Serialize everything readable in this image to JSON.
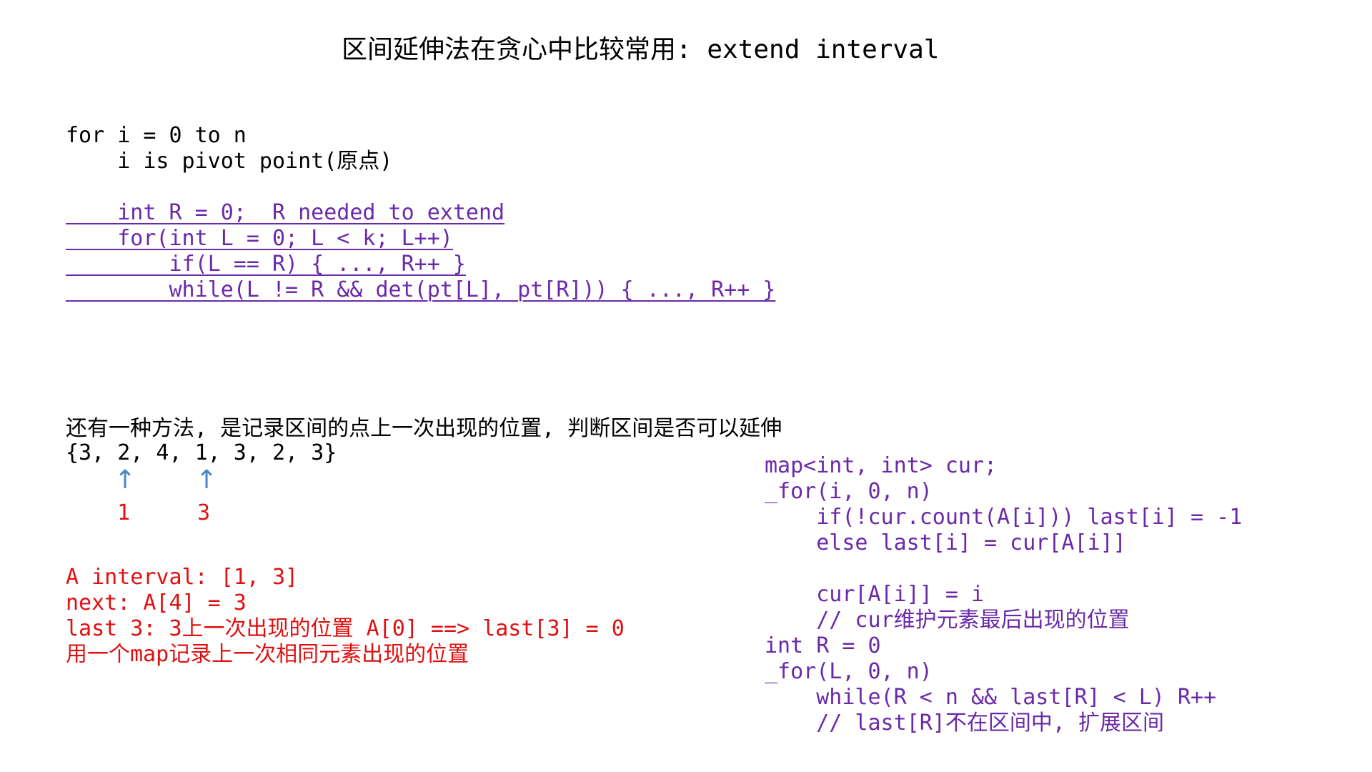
{
  "title": "区间延伸法在贪心中比较常用: extend interval",
  "top_code": {
    "line1": "for i = 0 to n",
    "line2": "    i is pivot point(原点)",
    "line3": "    int R = 0;  R needed to extend",
    "line4": "    for(int L = 0; L < k; L++)",
    "line5": "        if(L == R) { ..., R++ }",
    "line6": "        while(L != R && det(pt[L], pt[R])) { ..., R++ }"
  },
  "desc": {
    "line1": "还有一种方法, 是记录区间的点上一次出现的位置, 判断区间是否可以延伸",
    "array": "{3, 2, 4, 1, 3, 2, 3}",
    "arrow1": "↑",
    "arrow2": "↑",
    "label1": "1",
    "label2": "3"
  },
  "red_notes": {
    "line1": "A interval: [1, 3]",
    "line2": "next: A[4] = 3",
    "line3": "last 3: 3上一次出现的位置 A[0] ==> last[3] = 0",
    "line4": "用一个map记录上一次相同元素出现的位置"
  },
  "right_code": {
    "line1": "map<int, int> cur;",
    "line2": "_for(i, 0, n)",
    "line3": "    if(!cur.count(A[i])) last[i] = -1",
    "line4": "    else last[i] = cur[A[i]]",
    "line5": "    cur[A[i]] = i",
    "line6": "    // cur维护元素最后出现的位置",
    "line7": "int R = 0",
    "line8": "_for(L, 0, n)",
    "line9": "    while(R < n && last[R] < L) R++",
    "line10": "    // last[R]不在区间中, 扩展区间"
  },
  "colors": {
    "purple": "#6a2aa8",
    "red": "#e01010",
    "arrow_blue": "#4a86c8"
  }
}
